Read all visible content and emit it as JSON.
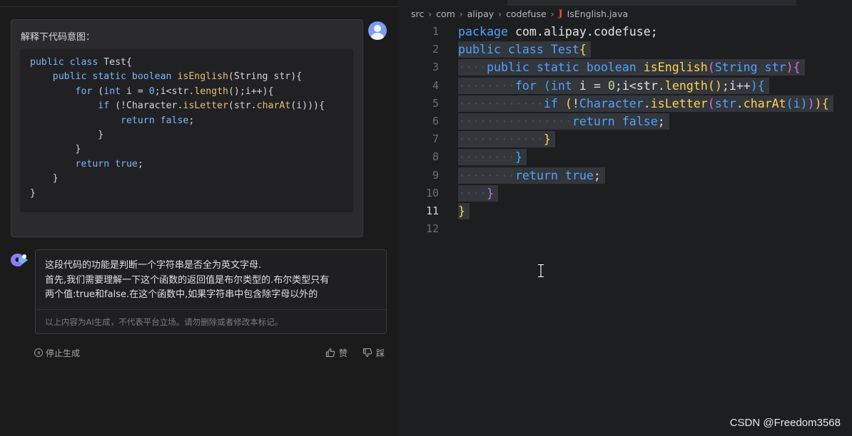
{
  "chat": {
    "user_prompt": "解释下代码意图：",
    "user_code_lines": [
      "public class Test{",
      "    public static boolean isEnglish(String str){",
      "        for (int i = 0;i<str.length();i++){",
      "            if (!Character.isLetter(str.charAt(i))){",
      "                return false;",
      "            }",
      "        }",
      "        return true;",
      "    }",
      "}"
    ],
    "ai_reply_lines": [
      "这段代码的功能是判断一个字符串是否全为英文字母.",
      "首先,我们需要理解一下这个函数的返回值是布尔类型的.布尔类型只有",
      "两个值:true和false.在这个函数中,如果字符串中包含除字母以外的"
    ],
    "ai_disclaimer": "以上内容为AI生成，不代表平台立场。请勿删除或者修改本标记。",
    "stop_label": "停止生成",
    "like_label": "赞",
    "dislike_label": "踩"
  },
  "editor": {
    "breadcrumb": [
      "src",
      "com",
      "alipay",
      "codefuse"
    ],
    "file_icon": "J",
    "file_name": "IsEnglish.java",
    "line_numbers": [
      "1",
      "2",
      "3",
      "4",
      "5",
      "6",
      "7",
      "8",
      "9",
      "10",
      "11",
      "12"
    ],
    "active_line": "11"
  },
  "watermark": "CSDN @Freedom3568",
  "colors": {
    "keyword": "#4fa3ff",
    "function": "#ffd34f",
    "selection": "#33363b",
    "bracket_purple": "#d070d8"
  }
}
